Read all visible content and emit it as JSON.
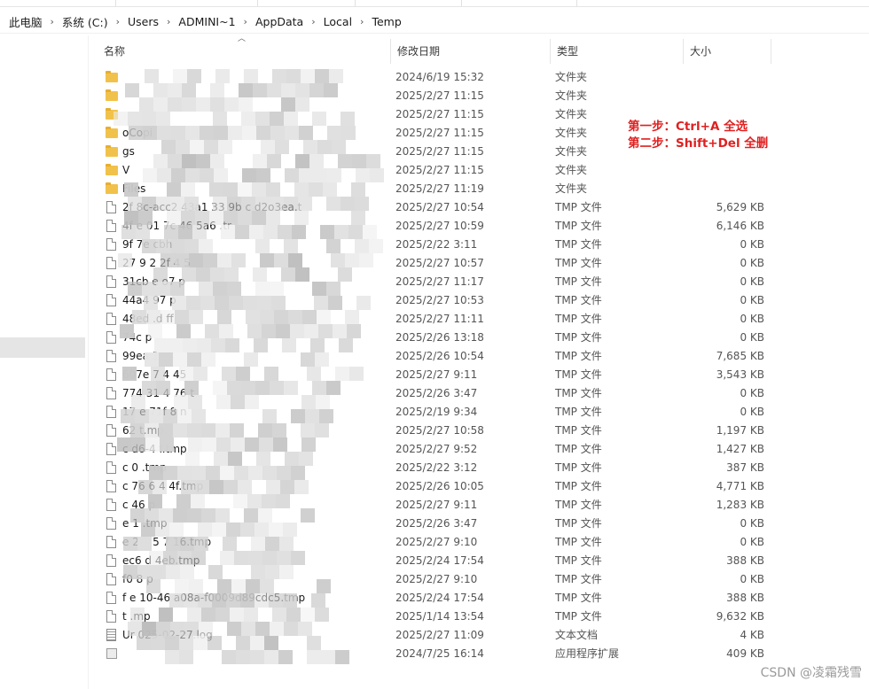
{
  "breadcrumb": {
    "items": [
      "此电脑",
      "系统 (C:)",
      "Users",
      "ADMINI~1",
      "AppData",
      "Local",
      "Temp"
    ],
    "separator": "›"
  },
  "columns": {
    "name": "名称",
    "date": "修改日期",
    "type": "类型",
    "size": "大小"
  },
  "files": [
    {
      "name": "",
      "date": "2024/6/19 15:32",
      "type": "文件夹",
      "size": "",
      "icon": "folder-icon"
    },
    {
      "name": "",
      "date": "2025/2/27 11:15",
      "type": "文件夹",
      "size": "",
      "icon": "folder-icon"
    },
    {
      "name": "",
      "date": "2025/2/27 11:15",
      "type": "文件夹",
      "size": "",
      "icon": "folder-icon"
    },
    {
      "name": "oCopi",
      "date": "2025/2/27 11:15",
      "type": "文件夹",
      "size": "",
      "icon": "folder-icon"
    },
    {
      "name": "gs",
      "date": "2025/2/27 11:15",
      "type": "文件夹",
      "size": "",
      "icon": "folder-icon"
    },
    {
      "name": "V",
      "date": "2025/2/27 11:15",
      "type": "文件夹",
      "size": "",
      "icon": "folder-icon"
    },
    {
      "name": "Files",
      "date": "2025/2/27 11:19",
      "type": "文件夹",
      "size": "",
      "icon": "folder-icon"
    },
    {
      "name": "2f 8c-acc2 43a1 33 9b c d2o3ea.t",
      "date": "2025/2/27 10:54",
      "type": "TMP 文件",
      "size": "5,629 KB",
      "icon": "file-icon"
    },
    {
      "name": "4f e 01 7c 46 5a6 .tr",
      "date": "2025/2/27 10:59",
      "type": "TMP 文件",
      "size": "6,146 KB",
      "icon": "file-icon"
    },
    {
      "name": "9f 7e cbh",
      "date": "2025/2/22 3:11",
      "type": "TMP 文件",
      "size": "0 KB",
      "icon": "file-icon"
    },
    {
      "name": "27 9 2 2f 4 5",
      "date": "2025/2/27 10:57",
      "type": "TMP 文件",
      "size": "0 KB",
      "icon": "file-icon"
    },
    {
      "name": "31cb e o7 p",
      "date": "2025/2/27 11:17",
      "type": "TMP 文件",
      "size": "0 KB",
      "icon": "file-icon"
    },
    {
      "name": "44a4 97 p",
      "date": "2025/2/27 10:53",
      "type": "TMP 文件",
      "size": "0 KB",
      "icon": "file-icon"
    },
    {
      "name": "48ed .d ff",
      "date": "2025/2/27 11:11",
      "type": "TMP 文件",
      "size": "0 KB",
      "icon": "file-icon"
    },
    {
      "name": "74c p",
      "date": "2025/2/26 13:18",
      "type": "TMP 文件",
      "size": "0 KB",
      "icon": "file-icon"
    },
    {
      "name": "99ea 1",
      "date": "2025/2/26 10:54",
      "type": "TMP 文件",
      "size": "7,685 KB",
      "icon": "file-icon"
    },
    {
      "name": "607e 7 4 45",
      "date": "2025/2/27 9:11",
      "type": "TMP 文件",
      "size": "3,543 KB",
      "icon": "file-icon"
    },
    {
      "name": "774 31 4 76 t",
      "date": "2025/2/26 3:47",
      "type": "TMP 文件",
      "size": "0 KB",
      "icon": "file-icon"
    },
    {
      "name": "17 e 71f 8 n",
      "date": "2025/2/19 9:34",
      "type": "TMP 文件",
      "size": "0 KB",
      "icon": "file-icon"
    },
    {
      "name": "62 t.mp",
      "date": "2025/2/27 10:58",
      "type": "TMP 文件",
      "size": "1,197 KB",
      "icon": "file-icon"
    },
    {
      "name": "c d6-4 f.tmp",
      "date": "2025/2/27 9:52",
      "type": "TMP 文件",
      "size": "1,427 KB",
      "icon": "file-icon"
    },
    {
      "name": "c 0 .tmp",
      "date": "2025/2/22 3:12",
      "type": "TMP 文件",
      "size": "387 KB",
      "icon": "file-icon"
    },
    {
      "name": "c 76 6 4 4f.tmp",
      "date": "2025/2/26 10:05",
      "type": "TMP 文件",
      "size": "4,771 KB",
      "icon": "file-icon"
    },
    {
      "name": "c 46 p",
      "date": "2025/2/27 9:11",
      "type": "TMP 文件",
      "size": "1,283 KB",
      "icon": "file-icon"
    },
    {
      "name": "e 1 .tmp",
      "date": "2025/2/26 3:47",
      "type": "TMP 文件",
      "size": "0 KB",
      "icon": "file-icon"
    },
    {
      "name": "e 2 4 5 7 16.tmp",
      "date": "2025/2/27 9:10",
      "type": "TMP 文件",
      "size": "0 KB",
      "icon": "file-icon"
    },
    {
      "name": "ec6 d 4eb.tmp",
      "date": "2025/2/24 17:54",
      "type": "TMP 文件",
      "size": "388 KB",
      "icon": "file-icon"
    },
    {
      "name": "f0 8 p",
      "date": "2025/2/27 9:10",
      "type": "TMP 文件",
      "size": "0 KB",
      "icon": "file-icon"
    },
    {
      "name": "f e 10-46 a08a-f0009d89cdc5.tmp",
      "date": "2025/2/24 17:54",
      "type": "TMP 文件",
      "size": "388 KB",
      "icon": "file-icon"
    },
    {
      "name": "t .mp",
      "date": "2025/1/14 13:54",
      "type": "TMP 文件",
      "size": "9,632 KB",
      "icon": "file-icon"
    },
    {
      "name": "Ur 025-02-27.log",
      "date": "2025/2/27 11:09",
      "type": "文本文档",
      "size": "4 KB",
      "icon": "doc-icon"
    },
    {
      "name": "",
      "date": "2024/7/25 16:14",
      "type": "应用程序扩展",
      "size": "409 KB",
      "icon": "ext-icon"
    }
  ],
  "annotation": {
    "line1": "第一步：Ctrl+A  全选",
    "line2": "第二步：Shift+Del  全删",
    "color": "#e02020"
  },
  "watermark": "CSDN @凌霜残雪",
  "colors": {
    "folder": "#f1c24b",
    "nav_selected": "#e5e5e5"
  }
}
